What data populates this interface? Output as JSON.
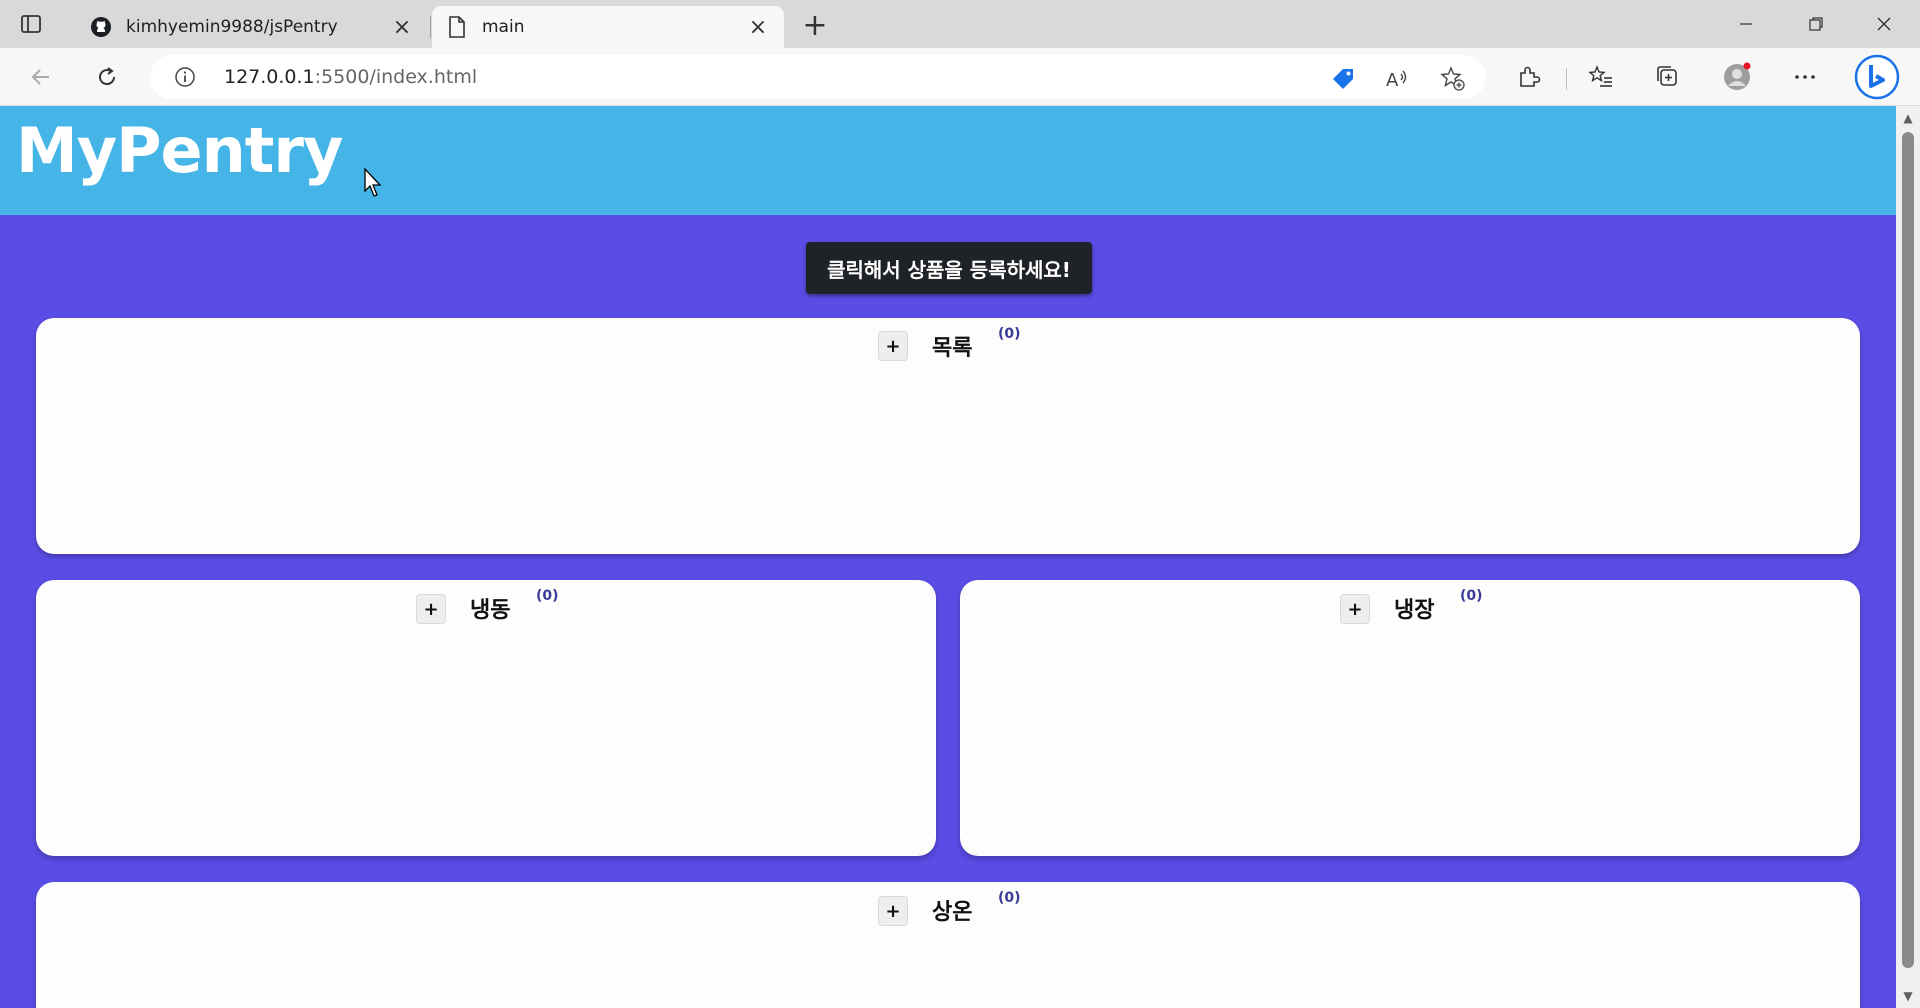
{
  "browser": {
    "tabs": [
      {
        "title": "kimhyemin9988/jsPentry",
        "icon": "github-icon",
        "active": false
      },
      {
        "title": "main",
        "icon": "page-icon",
        "active": true
      }
    ],
    "address": {
      "host": "127.0.0.1",
      "rest": ":5500/index.html"
    }
  },
  "page": {
    "site_title": "MyPentry",
    "register_button": "클릭해서 상품을 등록하세요!",
    "panels": [
      {
        "name": "목록",
        "count": "(0)",
        "add": "+"
      },
      {
        "name": "냉동",
        "count": "(0)",
        "add": "+"
      },
      {
        "name": "냉장",
        "count": "(0)",
        "add": "+"
      },
      {
        "name": "상온",
        "count": "(0)",
        "add": "+"
      }
    ]
  },
  "colors": {
    "header_bg": "#45b4e6",
    "page_bg": "#5a4de6",
    "panel_bg": "#fdfdfb",
    "button_bg": "#1f2226"
  }
}
